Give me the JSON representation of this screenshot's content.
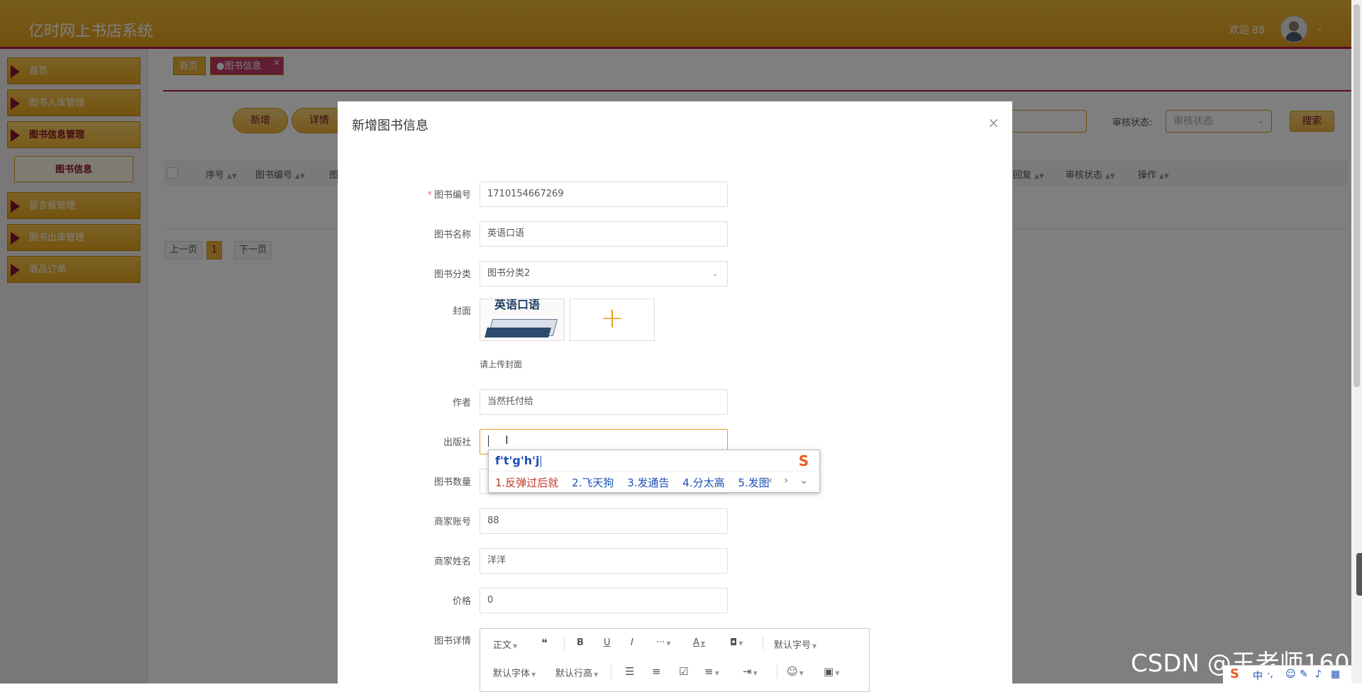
{
  "header": {
    "app_title": "亿时网上书店系统",
    "welcome": "欢迎 88",
    "avatar_icon": "user-avatar-icon",
    "chevron": "⌄"
  },
  "sidebar": {
    "items": [
      {
        "label": "首页"
      },
      {
        "label": "图书入库管理"
      },
      {
        "label": "图书信息管理"
      },
      {
        "label": "留言板管理"
      },
      {
        "label": "图书出库管理"
      },
      {
        "label": "商品订单"
      }
    ],
    "submenu": {
      "label": "图书信息"
    }
  },
  "tabs": {
    "home": "首页",
    "books": "●图书信息",
    "close": "×"
  },
  "toolbar": {
    "add": "新增",
    "detail": "详情",
    "audit_label": "审核状态:",
    "audit_placeholder": "审核状态",
    "search": "搜索"
  },
  "table": {
    "columns": [
      "序号",
      "图书编号",
      "图",
      "回复",
      "审核状态",
      "操作"
    ]
  },
  "pager": {
    "prev": "上一页",
    "current": "1",
    "next": "下一页"
  },
  "modal": {
    "title": "新增图书信息",
    "close": "×",
    "fields": {
      "book_no": {
        "label": "图书编号",
        "value": "1710154667269"
      },
      "book_name": {
        "label": "图书名称",
        "value": "英语口语"
      },
      "category": {
        "label": "图书分类",
        "value": "图书分类2"
      },
      "cover": {
        "label": "封面",
        "thumb_text": "英语口语",
        "hint": "请上传封面",
        "add": "+"
      },
      "author": {
        "label": "作者",
        "value": "当然托付给"
      },
      "publisher": {
        "label": "出版社",
        "value": ""
      },
      "quantity": {
        "label": "图书数量"
      },
      "merchant_account": {
        "label": "商家账号",
        "value": "88"
      },
      "merchant_name": {
        "label": "商家姓名",
        "value": "洋洋"
      },
      "price": {
        "label": "价格",
        "value": "0"
      },
      "detail": {
        "label": "图书详情"
      }
    },
    "editor": {
      "paragraph": "正文",
      "quote": "❝",
      "bold": "B",
      "underline": "U",
      "italic": "I",
      "more": "···",
      "font_color": "A",
      "bg_color": "◘",
      "font_size": "默认字号",
      "font_family": "默认字体",
      "line_height": "默认行高"
    }
  },
  "ime": {
    "composition": "f't'g'h'j",
    "logo": "S",
    "candidates": [
      "1.反弹过后就",
      "2.飞天狗",
      "3.发通告",
      "4.分太高",
      "5.发图"
    ],
    "nav": "‹ › ⌄"
  },
  "watermark": "CSDN @王老师160",
  "tray": {
    "logo": "S",
    "lang": "中",
    "punct": "·,",
    "emoji": "☺",
    "pen": "✎",
    "mic": "♪",
    "grid": "▦"
  }
}
